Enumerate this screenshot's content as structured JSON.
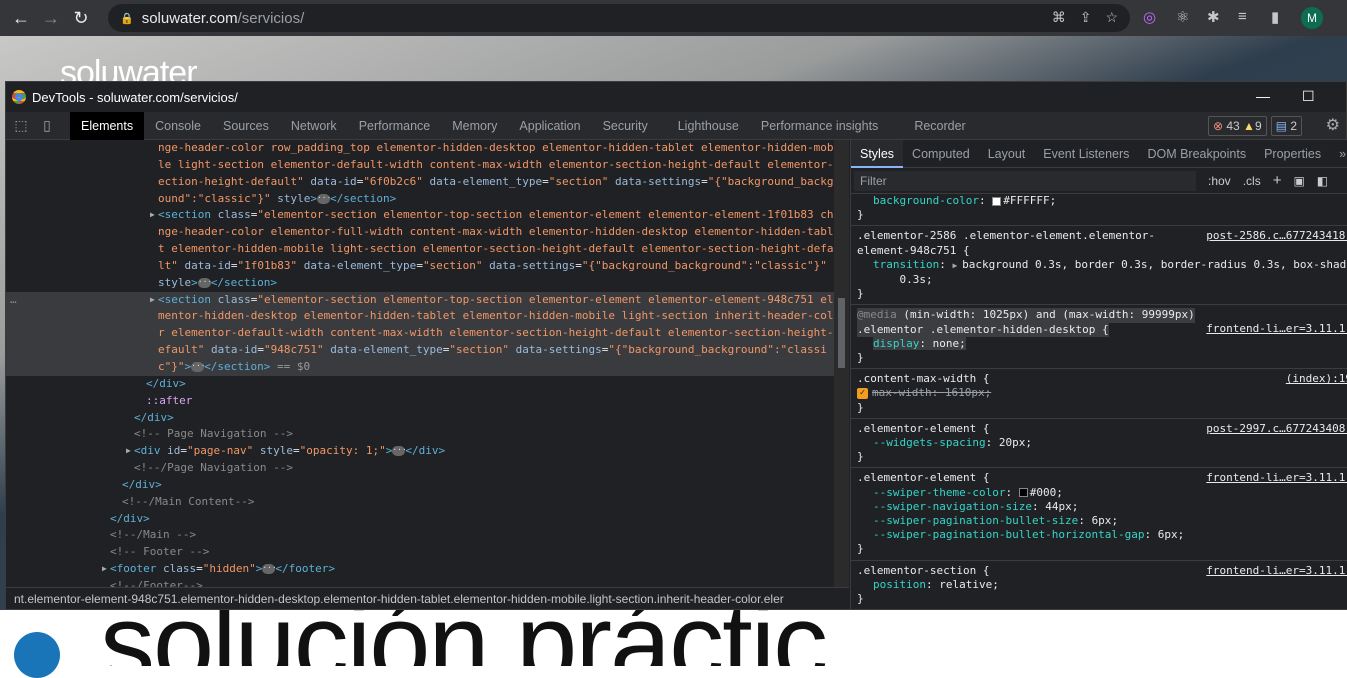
{
  "browser": {
    "url_host": "soluwater.com",
    "url_path": "/servicios/",
    "avatar_initial": "M",
    "icons": [
      "back-icon",
      "forward-icon",
      "reload-icon",
      "lock-icon",
      "translate-icon",
      "share-icon",
      "bookmark-star-icon",
      "extension-color-icon",
      "react-icon",
      "puzzle-icon",
      "media-icon",
      "sidebar-icon"
    ]
  },
  "page": {
    "logo": "soluwater",
    "big_text": "solución  práctic"
  },
  "devtools": {
    "title": "DevTools - soluwater.com/servicios/",
    "tabs": [
      "Elements",
      "Console",
      "Sources",
      "Network",
      "Performance",
      "Memory",
      "Application",
      "Security",
      "Lighthouse",
      "Performance insights",
      "Recorder"
    ],
    "active_tab": "Elements",
    "errors": "43",
    "warnings": "9",
    "messages": "2",
    "elements": [
      {
        "depth": 12,
        "seg": [
          [
            "av",
            "nge-header-color row_padding_top elementor-hidden-desktop elementor-hidden-tablet elementor-hidden-mobi"
          ]
        ]
      },
      {
        "depth": 12,
        "seg": [
          [
            "av",
            "le light-section elementor-default-width content-max-width elementor-section-height-default elementor-s"
          ]
        ]
      },
      {
        "depth": 12,
        "seg": [
          [
            "av",
            "ection-height-default\""
          ],
          [
            "an",
            " data-id"
          ],
          [
            "tx",
            "="
          ],
          [
            "av",
            "\"6f0b2c6\""
          ],
          [
            "an",
            " data-element_type"
          ],
          [
            "tx",
            "="
          ],
          [
            "av",
            "\"section\""
          ],
          [
            "an",
            " data-settings"
          ],
          [
            "tx",
            "="
          ],
          [
            "av",
            "\"{\"background_backgr"
          ]
        ]
      },
      {
        "depth": 12,
        "seg": [
          [
            "av",
            "ound\":\"classic\"}\""
          ],
          [
            "an",
            " style"
          ],
          [
            "tag",
            ">"
          ],
          [
            "ell",
            "…"
          ],
          [
            "tag",
            "</section>"
          ]
        ]
      },
      {
        "depth": 12,
        "arrow": true,
        "seg": [
          [
            "tag",
            "<section"
          ],
          [
            "an",
            " class"
          ],
          [
            "tx",
            "="
          ],
          [
            "av",
            "\"elementor-section elementor-top-section elementor-element elementor-element-1f01b83 cha"
          ]
        ]
      },
      {
        "depth": 12,
        "seg": [
          [
            "av",
            "nge-header-color elementor-full-width content-max-width elementor-hidden-desktop elementor-hidden-table"
          ]
        ]
      },
      {
        "depth": 12,
        "seg": [
          [
            "av",
            "t elementor-hidden-mobile light-section elementor-section-height-default elementor-section-height-defau"
          ]
        ]
      },
      {
        "depth": 12,
        "seg": [
          [
            "av",
            "lt\""
          ],
          [
            "an",
            " data-id"
          ],
          [
            "tx",
            "="
          ],
          [
            "av",
            "\"1f01b83\""
          ],
          [
            "an",
            " data-element_type"
          ],
          [
            "tx",
            "="
          ],
          [
            "av",
            "\"section\""
          ],
          [
            "an",
            " data-settings"
          ],
          [
            "tx",
            "="
          ],
          [
            "av",
            "\"{\"background_background\":\"classic\"}\""
          ]
        ]
      },
      {
        "depth": 12,
        "seg": [
          [
            "an",
            "style"
          ],
          [
            "tag",
            ">"
          ],
          [
            "ell",
            "…"
          ],
          [
            "tag",
            "</section>"
          ]
        ]
      },
      {
        "depth": 12,
        "arrow": true,
        "selected": true,
        "seg": [
          [
            "tag",
            "<section"
          ],
          [
            "an",
            " class"
          ],
          [
            "tx",
            "="
          ],
          [
            "av",
            "\"elementor-section elementor-top-section elementor-element elementor-element-948c751 ele"
          ]
        ]
      },
      {
        "depth": 12,
        "selected": true,
        "seg": [
          [
            "av",
            "mentor-hidden-desktop elementor-hidden-tablet elementor-hidden-mobile light-section inherit-header-colo"
          ]
        ]
      },
      {
        "depth": 12,
        "selected": true,
        "seg": [
          [
            "av",
            "r elementor-default-width content-max-width elementor-section-height-default elementor-section-height-d"
          ]
        ]
      },
      {
        "depth": 12,
        "selected": true,
        "seg": [
          [
            "av",
            "efault\""
          ],
          [
            "an",
            " data-id"
          ],
          [
            "tx",
            "="
          ],
          [
            "av",
            "\"948c751\""
          ],
          [
            "an",
            " data-element_type"
          ],
          [
            "tx",
            "="
          ],
          [
            "av",
            "\"section\""
          ],
          [
            "an",
            " data-settings"
          ],
          [
            "tx",
            "="
          ],
          [
            "av",
            "\"{\"background_background\":\"classi"
          ]
        ]
      },
      {
        "depth": 12,
        "selected": true,
        "seg": [
          [
            "av",
            "c\"}\""
          ],
          [
            "tag",
            ">"
          ],
          [
            "ell",
            "…"
          ],
          [
            "tag",
            "</section>"
          ],
          [
            "dim",
            " == $0"
          ]
        ]
      },
      {
        "depth": 11,
        "seg": [
          [
            "tag",
            "</div>"
          ]
        ]
      },
      {
        "depth": 11,
        "seg": [
          [
            "ps",
            "::after"
          ]
        ]
      },
      {
        "depth": 10,
        "seg": [
          [
            "tag",
            "</div>"
          ]
        ]
      },
      {
        "depth": 10,
        "seg": [
          [
            "cm",
            "<!-- Page Navigation -->"
          ]
        ]
      },
      {
        "depth": 10,
        "arrow": true,
        "seg": [
          [
            "tag",
            "<div"
          ],
          [
            "an",
            " id"
          ],
          [
            "tx",
            "="
          ],
          [
            "av",
            "\"page-nav\""
          ],
          [
            "an",
            " style"
          ],
          [
            "tx",
            "="
          ],
          [
            "av",
            "\"opacity: 1;\""
          ],
          [
            "tag",
            ">"
          ],
          [
            "ell",
            "…"
          ],
          [
            "tag",
            "</div>"
          ]
        ]
      },
      {
        "depth": 10,
        "seg": [
          [
            "cm",
            "<!--/Page Navigation -->"
          ]
        ]
      },
      {
        "depth": 9,
        "seg": [
          [
            "tag",
            "</div>"
          ]
        ]
      },
      {
        "depth": 9,
        "seg": [
          [
            "cm",
            "<!--/Main Content-->"
          ]
        ]
      },
      {
        "depth": 8,
        "seg": [
          [
            "tag",
            "</div>"
          ]
        ]
      },
      {
        "depth": 8,
        "seg": [
          [
            "cm",
            "<!--/Main -->"
          ]
        ]
      },
      {
        "depth": 8,
        "seg": [
          [
            "cm",
            "<!-- Footer -->"
          ]
        ]
      },
      {
        "depth": 8,
        "arrow": true,
        "seg": [
          [
            "tag",
            "<footer"
          ],
          [
            "an",
            " class"
          ],
          [
            "tx",
            "="
          ],
          [
            "av",
            "\"hidden\""
          ],
          [
            "tag",
            ">"
          ],
          [
            "ell",
            "…"
          ],
          [
            "tag",
            "</footer>"
          ]
        ]
      },
      {
        "depth": 8,
        "seg": [
          [
            "cm",
            "<!--/Footer-->"
          ]
        ]
      }
    ],
    "breadcrumb": "nt.elementor-element-948c751.elementor-hidden-desktop.elementor-hidden-tablet.elementor-hidden-mobile.light-section.inherit-header-color.eler",
    "styles": {
      "tabs": [
        "Styles",
        "Computed",
        "Layout",
        "Event Listeners",
        "DOM Breakpoints",
        "Properties"
      ],
      "active_tab": "Styles",
      "filter_placeholder": "Filter",
      "hov": ":hov",
      "cls": ".cls",
      "rules": [
        {
          "selector": "",
          "props": [
            {
              "name": "background-color",
              "value": "#FFFFFF",
              "swatch": "#FFFFFF"
            }
          ]
        },
        {
          "selector": ".elementor-2586 .elementor-element.elementor-\nelement-948c751 {",
          "source": "post-2586.c…677243418:",
          "props": [
            {
              "name": "transition",
              "value": "background 0.3s, border 0.3s, border-radius 0.3s, box-shado\n    0.3s",
              "expand": true
            }
          ]
        },
        {
          "media": "@media (min-width: 1025px) and (max-width: 99999px)",
          "selector": ".elementor .elementor-hidden-desktop {",
          "source": "frontend-li…er=3.11.1:",
          "highlight": true,
          "props": [
            {
              "name": "display",
              "value": "none"
            }
          ]
        },
        {
          "selector": ".content-max-width {",
          "source": "(index):19",
          "props": [
            {
              "name": "max-width",
              "value": "1610px",
              "struck": true,
              "checked": true
            }
          ]
        },
        {
          "selector": ".elementor-element {",
          "source": "post-2997.c…677243408:",
          "props": [
            {
              "name": "--widgets-spacing",
              "value": "20px"
            }
          ]
        },
        {
          "selector": ".elementor-element {",
          "source": "frontend-li…er=3.11.1:",
          "props": [
            {
              "name": "--swiper-theme-color",
              "value": "#000",
              "swatch": "#000000"
            },
            {
              "name": "--swiper-navigation-size",
              "value": "44px"
            },
            {
              "name": "--swiper-pagination-bullet-size",
              "value": "6px"
            },
            {
              "name": "--swiper-pagination-bullet-horizontal-gap",
              "value": "6px"
            }
          ]
        },
        {
          "selector": ".elementor-section {",
          "source": "frontend-li…er=3.11.1:",
          "props": [
            {
              "name": "position",
              "value": "relative"
            }
          ]
        }
      ]
    }
  }
}
